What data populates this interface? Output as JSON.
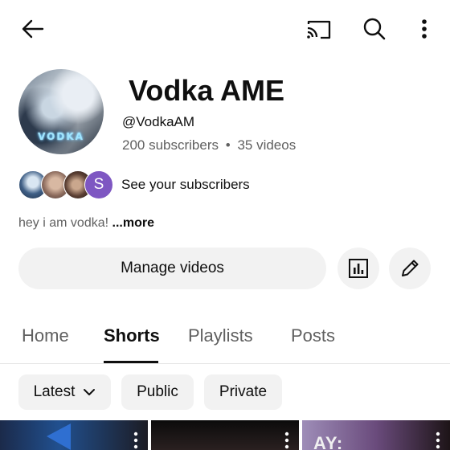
{
  "channel": {
    "name": "Vodka AME",
    "handle": "@VodkaAM",
    "subscribers": "200 subscribers",
    "separator": "•",
    "videos": "35 videos",
    "avatar_logo_text": "VODKA",
    "see_subscribers": "See your subscribers",
    "subscriber_initial": "S",
    "bio": "hey i am vodka!",
    "bio_more": "...more"
  },
  "actions": {
    "manage_videos": "Manage videos"
  },
  "tabs": [
    {
      "label": "Home"
    },
    {
      "label": "Shorts",
      "active": true
    },
    {
      "label": "Playlists"
    },
    {
      "label": "Posts"
    }
  ],
  "filters": {
    "sort": "Latest",
    "chips": [
      "Public",
      "Private"
    ]
  },
  "thumbnails": [
    {
      "caption": ""
    },
    {
      "caption": ""
    },
    {
      "caption": "AY:"
    }
  ],
  "icons": {
    "back": "arrow-left-icon",
    "cast": "cast-icon",
    "search": "search-icon",
    "menu": "more-vertical-icon",
    "analytics": "bar-chart-icon",
    "edit": "pencil-icon"
  },
  "colors": {
    "accent_subscriber": "#7e57c2",
    "chip_bg": "#f2f2f2",
    "secondary_text": "#606060"
  }
}
